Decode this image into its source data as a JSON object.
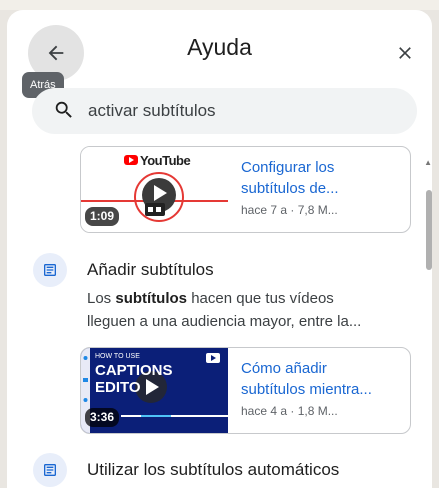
{
  "header": {
    "title": "Ayuda",
    "back_tooltip": "Atrás"
  },
  "search": {
    "query": "activar subtítulos"
  },
  "results": [
    {
      "type": "video",
      "thumb_brand": "YouTube",
      "duration": "1:09",
      "title_line1": "Configurar los",
      "title_line2": "subtítulos de...",
      "meta": "hace 7 a · 7,8 M..."
    },
    {
      "type": "article",
      "title": "Añadir subtítulos",
      "snippet_bold": "subtítulos",
      "snippet_pre": "Los ",
      "snippet_post": " hacen que tus vídeos",
      "snippet_line2": "lleguen a una audiencia mayor, entre la..."
    },
    {
      "type": "video",
      "thumb_small": "HOW TO USE",
      "thumb_big1": "CAPTIONS",
      "thumb_big2": "EDITO",
      "duration": "3:36",
      "title_line1": "Cómo añadir",
      "title_line2": "subtítulos mientra...",
      "meta": "hace 4 a · 1,8 M..."
    },
    {
      "type": "article",
      "title": "Utilizar los subtítulos automáticos"
    }
  ],
  "colors": {
    "link": "#1a67d2",
    "icon_bg": "#e8eefa",
    "youtube_red": "#ff0000",
    "captions_blue": "#0b1f78"
  }
}
